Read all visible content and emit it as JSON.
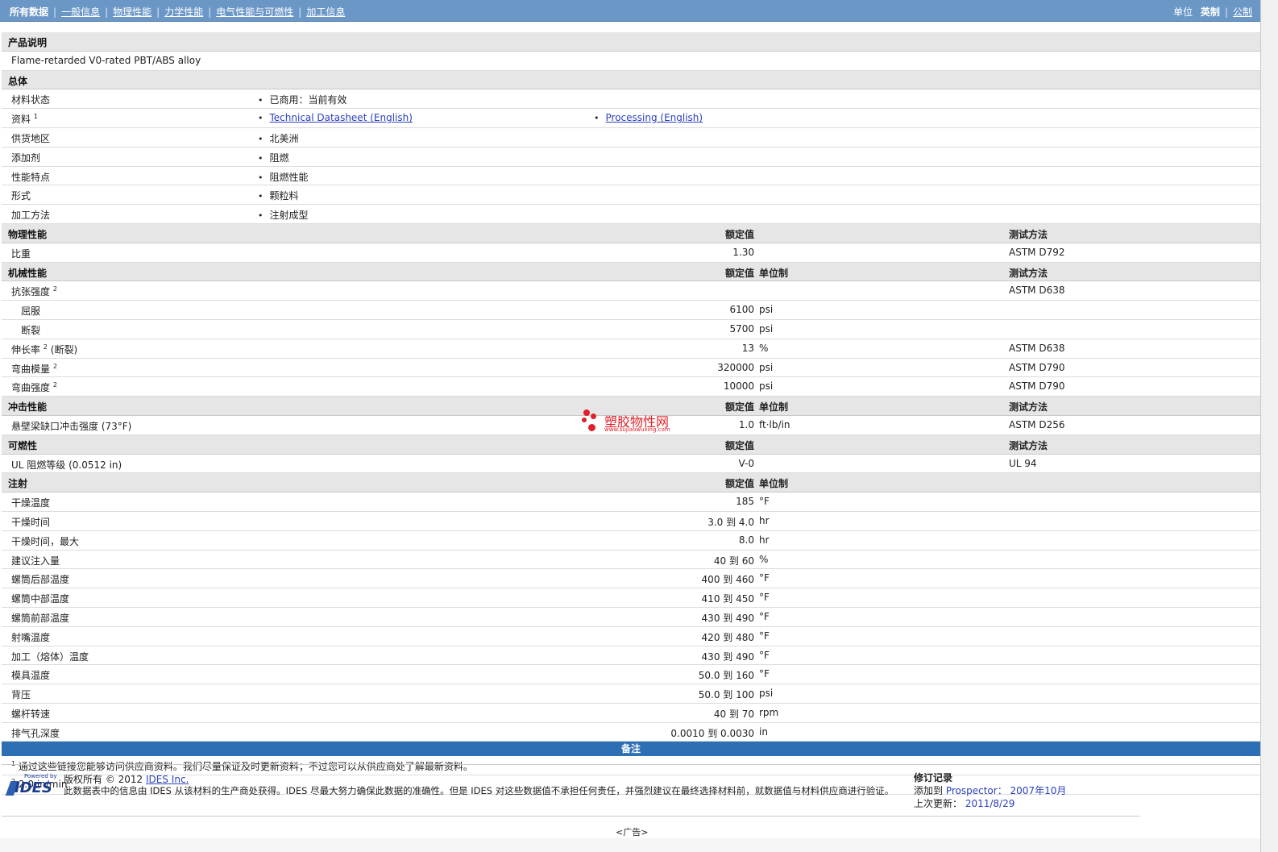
{
  "nav": {
    "items": [
      "所有数据",
      "一般信息",
      "物理性能",
      "力学性能",
      "电气性能与可燃性",
      "加工信息"
    ],
    "units_label": "单位",
    "units_selected": "英制",
    "units_other": "公制"
  },
  "sections": {
    "desc_title": "产品说明",
    "desc_text": "Flame-retarded V0-rated PBT/ABS alloy",
    "general_title": "总体",
    "physical_title": "物理性能",
    "mechanical_title": "机械性能",
    "impact_title": "冲击性能",
    "flammability_title": "可燃性",
    "injection_title": "注射",
    "col_nominal": "额定值",
    "col_unit": "单位制",
    "col_method": "测试方法"
  },
  "general": {
    "status_label": "材料状态",
    "status_value": "已商用：当前有效",
    "docs_label": "资料",
    "docs_sup": "1",
    "doc1": "Technical Datasheet (English)",
    "doc2": "Processing (English)",
    "region_label": "供货地区",
    "region_value": "北美洲",
    "additive_label": "添加剂",
    "additive_value": "阻燃",
    "features_label": "性能特点",
    "features_value": "阻燃性能",
    "form_label": "形式",
    "form_value": "颗粒料",
    "process_label": "加工方法",
    "process_value": "注射成型"
  },
  "physical": [
    {
      "label": "比重",
      "value": "1.30",
      "unit": "",
      "method": "ASTM D792"
    }
  ],
  "mechanical": {
    "tensile_label": "抗张强度",
    "tensile_sup": "2",
    "tensile_method": "ASTM D638",
    "yield_label": "屈服",
    "yield_value": "6100",
    "yield_unit": "psi",
    "break_label": "断裂",
    "break_value": "5700",
    "break_unit": "psi",
    "elong_label": "伸长率",
    "elong_sup": "2",
    "elong_suffix": "(断裂)",
    "elong_value": "13",
    "elong_unit": "%",
    "elong_method": "ASTM D638",
    "flexmod_label": "弯曲模量",
    "flexmod_sup": "2",
    "flexmod_value": "320000",
    "flexmod_unit": "psi",
    "flexmod_method": "ASTM D790",
    "flexstr_label": "弯曲强度",
    "flexstr_sup": "2",
    "flexstr_value": "10000",
    "flexstr_unit": "psi",
    "flexstr_method": "ASTM D790"
  },
  "impact": [
    {
      "label": "悬壁梁缺口冲击强度  (73°F)",
      "value": "1.0",
      "unit": "ft·lb/in",
      "method": "ASTM D256"
    }
  ],
  "flammability": [
    {
      "label": "UL 阻燃等级  (0.0512 in)",
      "value": "V-0",
      "unit": "",
      "method": "UL 94"
    }
  ],
  "injection": [
    {
      "label": "干燥温度",
      "value": "185",
      "unit": "°F"
    },
    {
      "label": "干燥时间",
      "value": "3.0 到  4.0",
      "unit": "hr"
    },
    {
      "label": "干燥时间，最大",
      "value": "8.0",
      "unit": "hr"
    },
    {
      "label": "建议注入量",
      "value": "40 到  60",
      "unit": "%"
    },
    {
      "label": "螺筒后部温度",
      "value": "400 到  460",
      "unit": "°F"
    },
    {
      "label": "螺筒中部温度",
      "value": "410 到  450",
      "unit": "°F"
    },
    {
      "label": "螺筒前部温度",
      "value": "430 到  490",
      "unit": "°F"
    },
    {
      "label": "射嘴温度",
      "value": "420 到  480",
      "unit": "°F"
    },
    {
      "label": "加工（熔体）温度",
      "value": "430 到  490",
      "unit": "°F"
    },
    {
      "label": "模具温度",
      "value": "50.0 到  160",
      "unit": "°F"
    },
    {
      "label": "背压",
      "value": "50.0 到  100",
      "unit": "psi"
    },
    {
      "label": "螺杆转速",
      "value": "40 到  70",
      "unit": "rpm"
    },
    {
      "label": "排气孔深度",
      "value": "0.0010 到  0.0030",
      "unit": "in"
    }
  ],
  "notes": {
    "title": "备注",
    "n1_sup": "1",
    "n1_text": "通过这些链接您能够访问供应商资料。我们尽量保证及时更新资料；不过您可以从供应商处了解最新资料。",
    "n2_sup": "2",
    "n2_text": "2.0 in/min"
  },
  "footer": {
    "logo_small": "Powered by",
    "logo_name": "IDES",
    "copyright": "版权所有  © 2012",
    "company_link": "IDES Inc.",
    "disclaimer": "此数据表中的信息由  IDES 从该材料的生产商处获得。IDES 尽最大努力确保此数据的准确性。但是  IDES 对这些数据值不承担任何责任，并强烈建议在最终选择材料前，就数据值与材料供应商进行验证。",
    "rev_title": "修订记录",
    "added_label": "添加到 ",
    "added_product": "Prospector：",
    "added_date": "2007年10月",
    "updated_label": "上次更新：",
    "updated_date": "2011/8/29",
    "ad_label": "<广告>"
  },
  "watermark": {
    "title": "塑胶物性网",
    "url": "www.sujiaowuxing.com",
    "color": "#e0202a"
  },
  "colors": {
    "topbar": "#6b97c7",
    "notes_bar": "#2d6fb4",
    "section_header": "#e6e6e6",
    "link": "#2a3fbf"
  }
}
